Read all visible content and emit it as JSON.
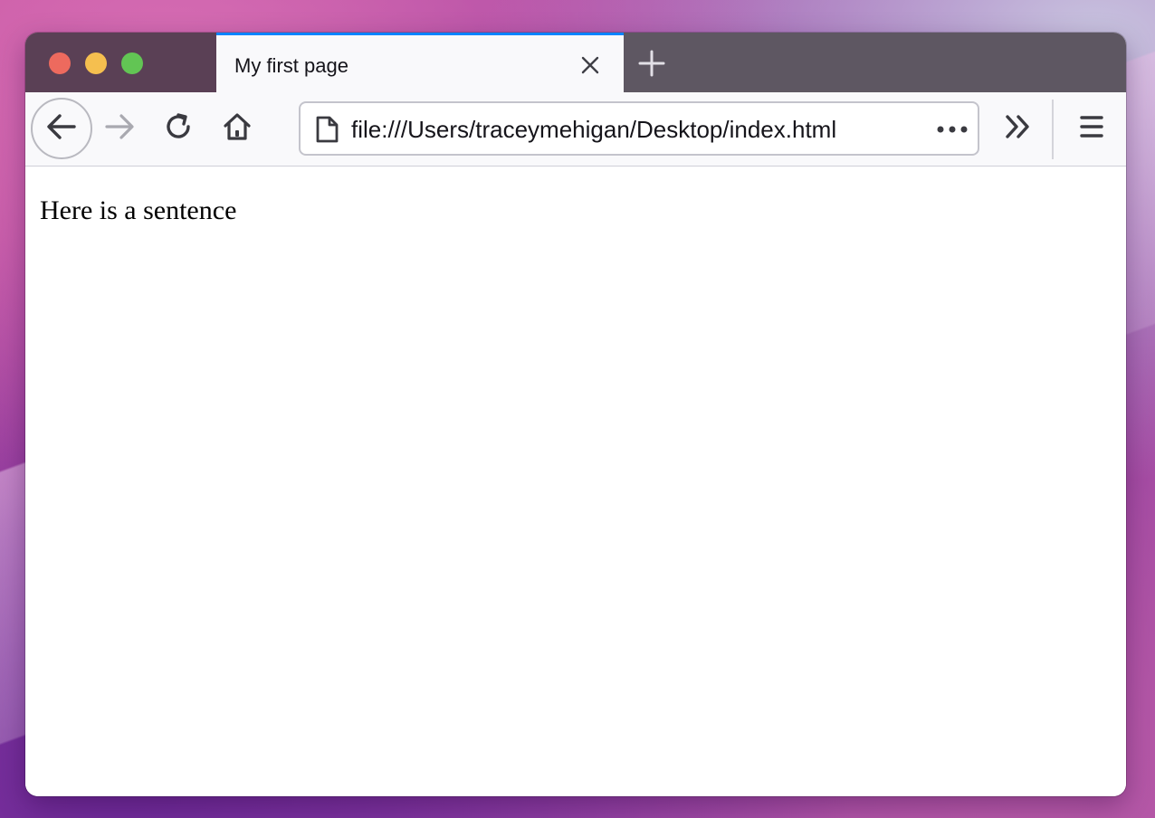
{
  "window": {
    "controls": [
      "close",
      "minimize",
      "maximize"
    ]
  },
  "tab": {
    "title": "My first page",
    "close_icon": "close-icon"
  },
  "newtab": {
    "icon": "plus-icon"
  },
  "toolbar": {
    "back_icon": "arrow-left-icon",
    "forward_icon": "arrow-right-icon",
    "reload_icon": "reload-icon",
    "home_icon": "home-icon",
    "overflow_icon": "chevron-double-right-icon",
    "menu_icon": "hamburger-icon"
  },
  "urlbar": {
    "url": "file:///Users/traceymehigan/Desktop/index.html",
    "page_icon": "document-icon",
    "more_icon": "ellipsis-icon"
  },
  "content": {
    "text": "Here is a sentence"
  },
  "colors": {
    "accent": "#0a84ff",
    "tabbar": "#5e5762",
    "toolbar": "#f9f9fb",
    "close": "#ed6a5e",
    "minimize": "#f5bf4f",
    "maximize": "#62c554"
  }
}
